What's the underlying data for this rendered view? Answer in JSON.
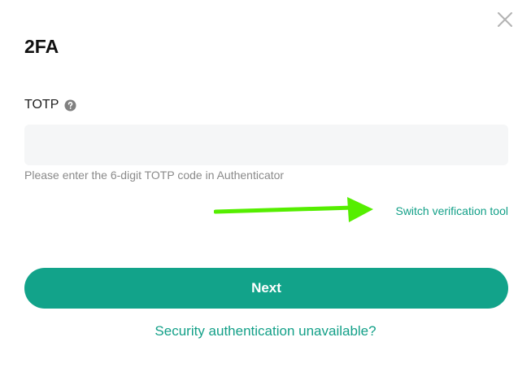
{
  "dialog": {
    "title": "2FA",
    "close_icon": "close-icon"
  },
  "field": {
    "label": "TOTP",
    "help_icon": "question-circle-icon",
    "value": "",
    "placeholder": "",
    "hint": "Please enter the 6-digit TOTP code in Authenticator"
  },
  "links": {
    "switch_tool": "Switch verification tool",
    "unavailable": "Security authentication unavailable?"
  },
  "actions": {
    "next_label": "Next"
  },
  "annotation": {
    "arrow_icon": "green-arrow-annotation"
  },
  "colors": {
    "accent": "#12a38a",
    "link": "#13a088",
    "input_bg": "#f5f6f7",
    "annotation": "#55ee00"
  }
}
